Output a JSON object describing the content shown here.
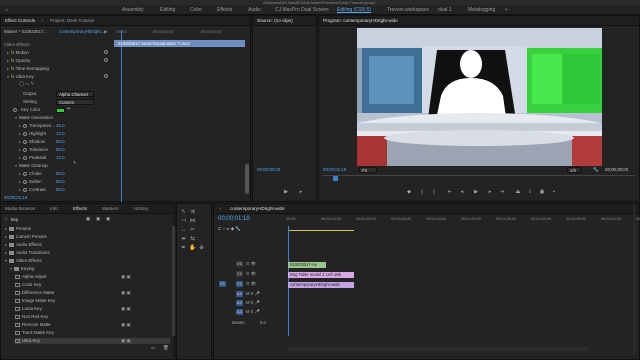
{
  "window_title": "/Volumes/NO NAME/Desk folder/Premiere/Desk Tutorial.prproj *",
  "workspaces": [
    "Assembly",
    "Editing",
    "Color",
    "Effects",
    "Audio",
    "CJ MacPro Dual Screen",
    "Editing (CS5.5)",
    "Trevors workspace",
    "dual 1",
    "Metalogging"
  ],
  "active_workspace": "Editing (CS5.5)",
  "effect_controls": {
    "tabs": [
      "Effect Controls",
      "Project: Desk Tutorial"
    ],
    "master_label": "Master * 010833517...",
    "clip_label": "contemporaryHDright...",
    "timecodes": [
      ":00:00",
      "00;00;08;00",
      "00;00;16;00"
    ],
    "clip_name": "010833517-news-broadcaster-7.mov",
    "video_effects_label": "Video Effects",
    "items": [
      {
        "label": "Motion",
        "indent": 1,
        "fx": true
      },
      {
        "label": "Opacity",
        "indent": 1,
        "fx": true
      },
      {
        "label": "Time Remapping",
        "indent": 1,
        "fx": true
      },
      {
        "label": "Ultra Key",
        "indent": 1,
        "fx": true,
        "open": true
      }
    ],
    "output_label": "Output",
    "output_value": "Alpha Channel",
    "setting_label": "Setting",
    "setting_value": "Custom",
    "key_color_label": "Key Color",
    "matte_generation_label": "Matte Generation",
    "matte_params": [
      {
        "label": "Transparen...",
        "value": "45.0"
      },
      {
        "label": "Highlight",
        "value": "10.0"
      },
      {
        "label": "Shadow",
        "value": "50.0"
      },
      {
        "label": "Tolerance",
        "value": "50.0"
      },
      {
        "label": "Pedestal",
        "value": "10.0"
      }
    ],
    "matte_cleanup_label": "Matte Cleanup",
    "cleanup_params": [
      {
        "label": "Choke",
        "value": "50.0"
      },
      {
        "label": "Soften",
        "value": "50.0"
      },
      {
        "label": "Contrast",
        "value": "50.0"
      }
    ],
    "footer_time": "00;00;01;18"
  },
  "source": {
    "tab": "Source: (no clips)",
    "time": "00;00;00;00"
  },
  "program": {
    "tab": "Program: contemporaryHDright-wide",
    "current_time": "00;00;01;18",
    "zoom": "Fit",
    "resolution": "1/2",
    "duration": "00;00;30;00"
  },
  "effects_panel": {
    "tabs": [
      "Media Browser",
      "Info",
      "Effects",
      "Markers",
      "History"
    ],
    "active_tab": "Effects",
    "search_value": "key",
    "items": [
      {
        "label": "Presets",
        "indent": 0,
        "type": "folder"
      },
      {
        "label": "Lumetri Presets",
        "indent": 0,
        "type": "folder"
      },
      {
        "label": "Audio Effects",
        "indent": 0,
        "type": "folder"
      },
      {
        "label": "Audio Transitions",
        "indent": 0,
        "type": "folder"
      },
      {
        "label": "Video Effects",
        "indent": 0,
        "type": "folder",
        "open": true
      },
      {
        "label": "Keying",
        "indent": 1,
        "type": "folder",
        "open": true
      },
      {
        "label": "Alpha Adjust",
        "indent": 2,
        "type": "effect"
      },
      {
        "label": "Color Key",
        "indent": 2,
        "type": "effect"
      },
      {
        "label": "Difference Matte",
        "indent": 2,
        "type": "effect"
      },
      {
        "label": "Image Matte Key",
        "indent": 2,
        "type": "effect"
      },
      {
        "label": "Luma Key",
        "indent": 2,
        "type": "effect"
      },
      {
        "label": "Non Red Key",
        "indent": 2,
        "type": "effect"
      },
      {
        "label": "Remove Matte",
        "indent": 2,
        "type": "effect"
      },
      {
        "label": "Track Matte Key",
        "indent": 2,
        "type": "effect"
      },
      {
        "label": "Ultra Key",
        "indent": 2,
        "type": "effect",
        "selected": true
      }
    ]
  },
  "timeline": {
    "tab": "contemporaryHDright-wide",
    "current_time": "00;00;01;18",
    "ruler": [
      "00;00",
      "00;00;16;00",
      "00;00;32;00",
      "00;00;48;00",
      "00;01;04;00",
      "00;01;20;00",
      "00;01;36;00",
      "00;01;52;00",
      "00;02;08;00",
      "00;02;24;00",
      "00;02;40;00"
    ],
    "video_tracks": [
      {
        "label": "V3",
        "clip": "010833517-ne",
        "color": "#9ac68a"
      },
      {
        "label": "V2",
        "clip": "Dsg Table model 2 Left 16b",
        "color": "#d9a8e8"
      },
      {
        "label": "V1",
        "clip": "contemporaryHDright-wide",
        "color": "#c5a4e6"
      }
    ],
    "audio_tracks": [
      "A1",
      "A2",
      "A3"
    ],
    "master_label": "Master",
    "master_value": "0.0"
  }
}
